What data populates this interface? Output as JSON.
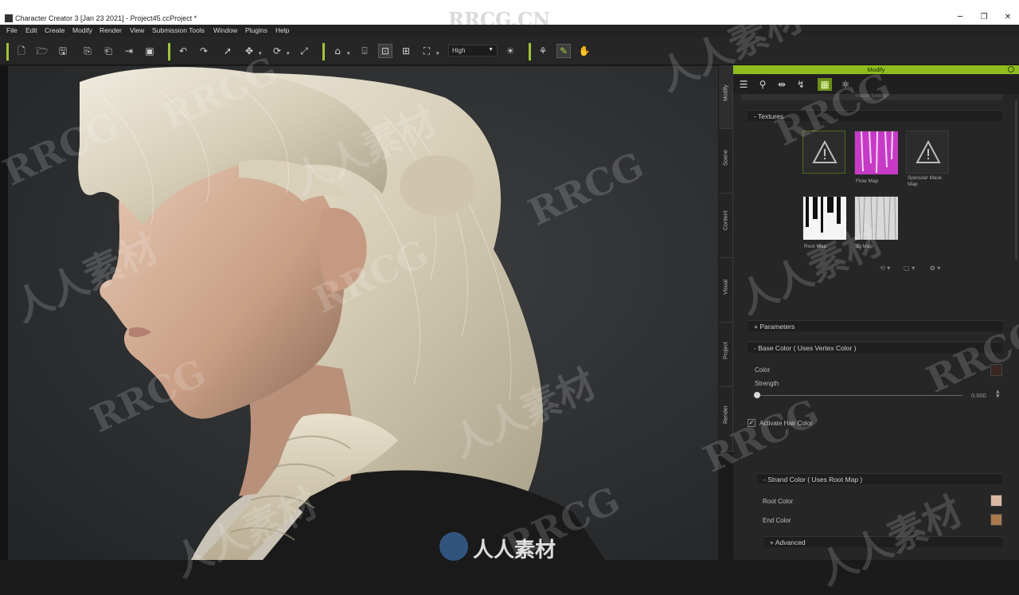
{
  "window": {
    "title": "Character Creator 3 [Jan 23 2021] - Project45.ccProject *",
    "minimize": "─",
    "maximize": "❐",
    "close": "✕",
    "watermark_top": "RRCG.CN"
  },
  "menu": [
    "File",
    "Edit",
    "Create",
    "Modify",
    "Render",
    "View",
    "Submission Tools",
    "Window",
    "Plugins",
    "Help"
  ],
  "toolbar": {
    "quality_value": "High",
    "icons": [
      "new-file-icon",
      "open-folder-icon",
      "save-icon",
      "import-icon",
      "export-icon",
      "send-icon",
      "render-icon",
      "undo-icon",
      "redo-icon",
      "select-icon",
      "move-icon",
      "rotate-icon",
      "scale-icon",
      "home-icon",
      "camera-fit-icon",
      "frame-selected-icon",
      "frame-all-icon",
      "screen-icon",
      "light-icon",
      "pose-icon",
      "edit-mesh-icon",
      "hand-icon"
    ]
  },
  "side_tabs": [
    "Modify",
    "Scene",
    "Content",
    "Visual",
    "Project",
    "Render"
  ],
  "panel": {
    "title": "Modify",
    "truncated_row": "Shader Settings",
    "textures": {
      "header": "- Textures",
      "slots": [
        {
          "label": "",
          "kind": "missing"
        },
        {
          "label": "Flow Map",
          "kind": "flow"
        },
        {
          "label": "Specular Mask Map",
          "kind": "missing"
        },
        {
          "label": "Root Map",
          "kind": "root"
        },
        {
          "label": "ID Map",
          "kind": "id"
        }
      ]
    },
    "parameters_header": "+ Parameters",
    "base_color": {
      "header": "- Base Color ( Uses Vertex Color )",
      "color_label": "Color",
      "color_value": "#3a2622",
      "strength_label": "Strength",
      "strength_value": "0.000",
      "strength_fraction": 0.0
    },
    "activate_hair_color": {
      "label": "Activate Hair Color",
      "checked": "✓"
    },
    "strand_color": {
      "header": "- Strand Color ( Uses Root Map )",
      "root_color_label": "Root Color",
      "root_color_value": "#d9b8a3",
      "end_color_label": "End Color",
      "end_color_value": "#a77a4f"
    },
    "advanced_header": "+ Advanced"
  },
  "watermarks": {
    "latin": "RRCG",
    "cjk": "人人素材",
    "logo": "人人素材"
  },
  "colors": {
    "accent": "#8fbc1f",
    "toolbar_separator": "#9fc43a"
  }
}
